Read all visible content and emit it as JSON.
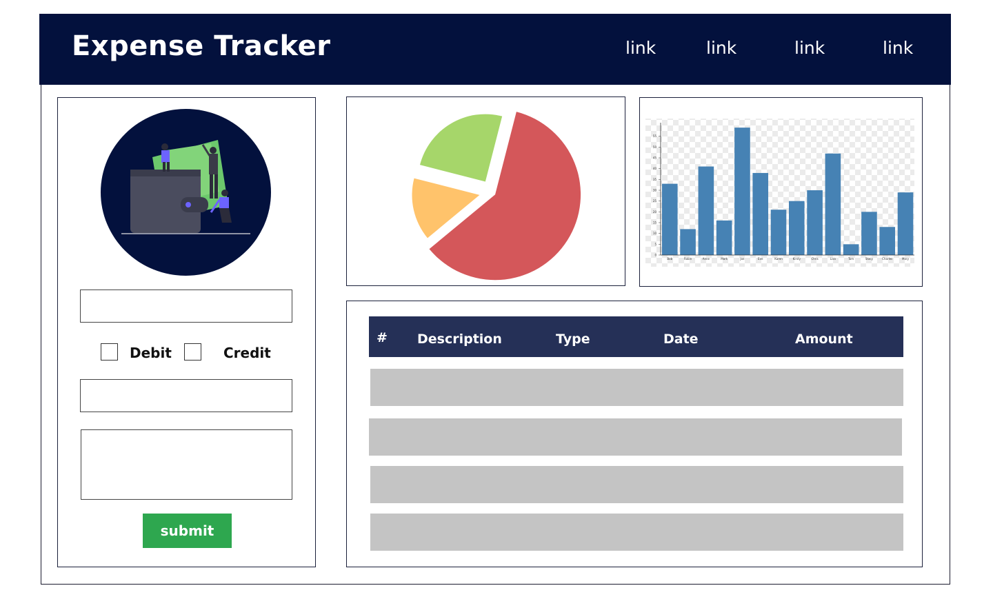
{
  "header": {
    "title": "Expense Tracker",
    "links": [
      "link",
      "link",
      "link",
      "link"
    ],
    "background": "#03113d"
  },
  "form": {
    "illustration_icon": "wallet-money-illustration",
    "checkboxes": [
      {
        "label": "Debit",
        "checked": false
      },
      {
        "label": "Credit",
        "checked": false
      }
    ],
    "amount_input": "",
    "date_input": "",
    "notes_textarea": "",
    "submit_label": "submit",
    "submit_color": "#2ea74f"
  },
  "table": {
    "columns": [
      "#",
      "Description",
      "Type",
      "Date",
      "Amount"
    ],
    "header_color": "#253057",
    "row_count_placeholders": 4
  },
  "chart_data": [
    {
      "type": "pie",
      "slices": [
        {
          "value": 60,
          "color": "#d4575a"
        },
        {
          "value": 15,
          "color": "#ffc36b"
        },
        {
          "value": 25,
          "color": "#a6d66a"
        }
      ],
      "exploded": true
    },
    {
      "type": "bar",
      "categories": [
        "Bob",
        "Robin",
        "Anne",
        "Mark",
        "Joe",
        "Eve",
        "Karen",
        "Kirsty",
        "Chris",
        "Lisa",
        "Tom",
        "Stacy",
        "Charles",
        "Mary"
      ],
      "values": [
        33,
        12,
        41,
        16,
        59,
        38,
        21,
        25,
        30,
        47,
        5,
        20,
        13,
        29
      ],
      "ylim": [
        0,
        60
      ],
      "yticks": [
        0,
        5,
        10,
        15,
        20,
        25,
        30,
        35,
        40,
        45,
        50,
        55
      ],
      "color": "#4682b4",
      "background": "checkerboard"
    }
  ]
}
